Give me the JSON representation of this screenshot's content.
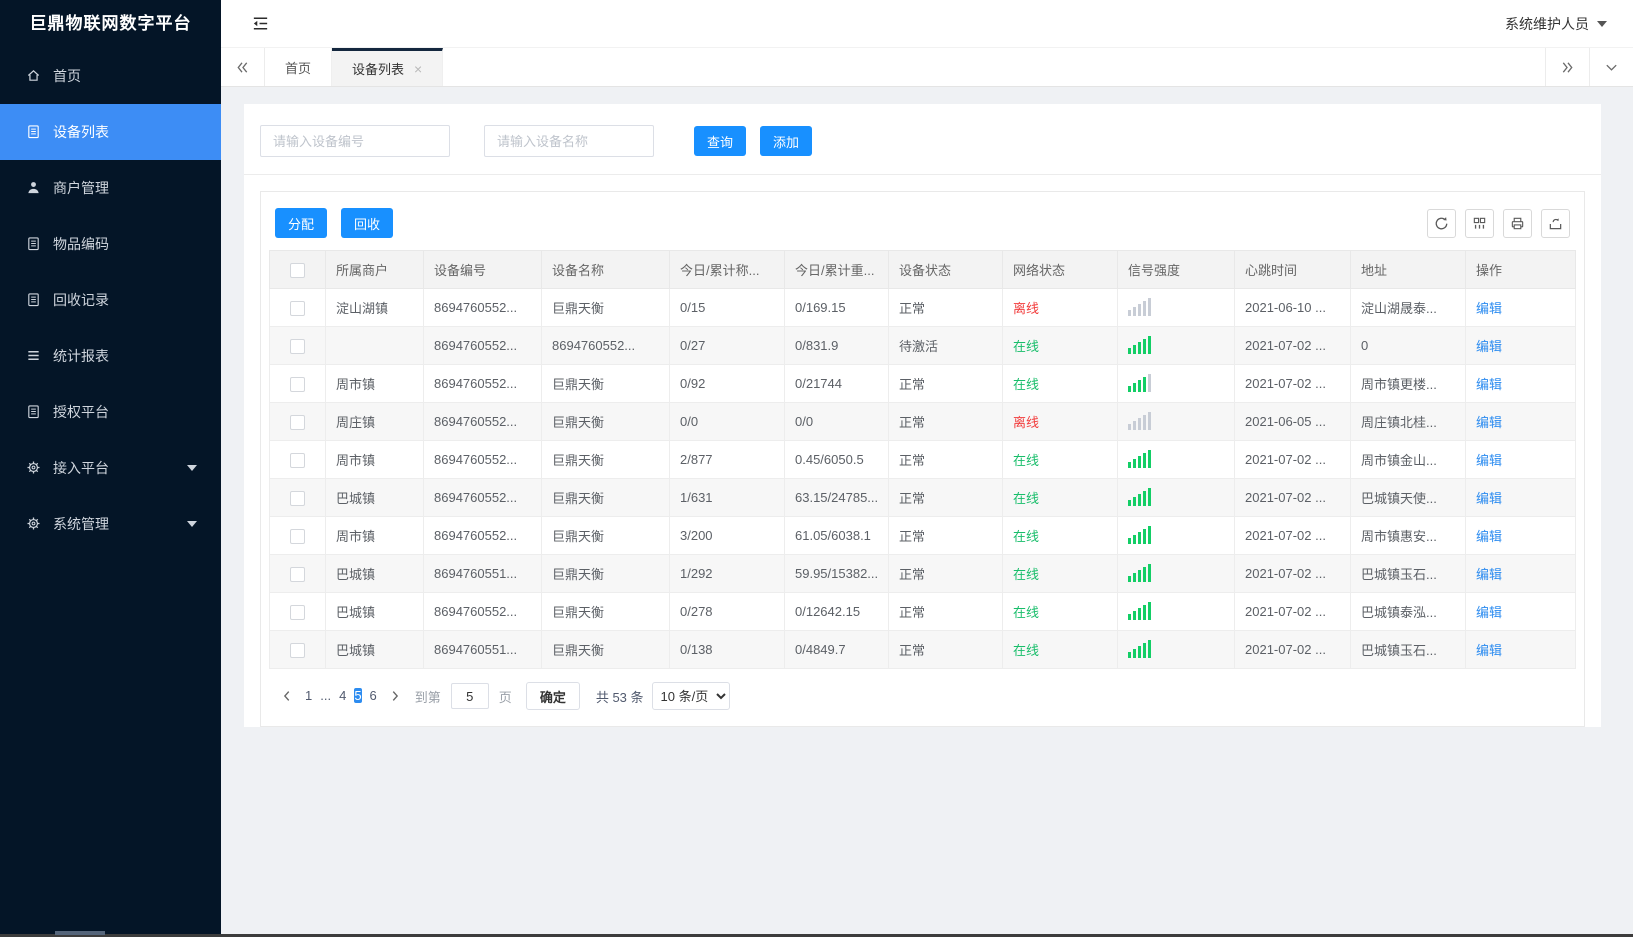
{
  "app": {
    "title": "巨鼎物联网数字平台",
    "user": "系统维护人员"
  },
  "sidebar": {
    "items": [
      {
        "id": "home",
        "label": "首页",
        "icon": "home-icon",
        "active": false,
        "expandable": false
      },
      {
        "id": "device-list",
        "label": "设备列表",
        "icon": "document-icon",
        "active": true,
        "expandable": false
      },
      {
        "id": "merchant-mgmt",
        "label": "商户管理",
        "icon": "user-icon",
        "active": false,
        "expandable": false
      },
      {
        "id": "item-code",
        "label": "物品编码",
        "icon": "document-icon",
        "active": false,
        "expandable": false
      },
      {
        "id": "recycle-record",
        "label": "回收记录",
        "icon": "document-icon",
        "active": false,
        "expandable": false
      },
      {
        "id": "stats-report",
        "label": "统计报表",
        "icon": "list-icon",
        "active": false,
        "expandable": false
      },
      {
        "id": "auth-platform",
        "label": "授权平台",
        "icon": "document-icon",
        "active": false,
        "expandable": false
      },
      {
        "id": "access-platform",
        "label": "接入平台",
        "icon": "gear-icon",
        "active": false,
        "expandable": true
      },
      {
        "id": "system-mgmt",
        "label": "系统管理",
        "icon": "gear-icon",
        "active": false,
        "expandable": true
      }
    ]
  },
  "tabs": [
    {
      "label": "首页",
      "active": false,
      "closable": false
    },
    {
      "label": "设备列表",
      "active": true,
      "closable": true
    }
  ],
  "search": {
    "device_no_placeholder": "请输入设备编号",
    "device_name_placeholder": "请输入设备名称",
    "query_label": "查询",
    "add_label": "添加"
  },
  "toolbar": {
    "assign_label": "分配",
    "recycle_label": "回收"
  },
  "table": {
    "headers": [
      "所属商户",
      "设备编号",
      "设备名称",
      "今日/累计称...",
      "今日/累计重...",
      "设备状态",
      "网络状态",
      "信号强度",
      "心跳时间",
      "地址",
      "操作"
    ],
    "edit_label": "编辑",
    "rows": [
      {
        "merchant": "淀山湖镇",
        "device_no": "8694760552...",
        "device_name": "巨鼎天衡",
        "today_count": "0/15",
        "today_weight": "0/169.15",
        "device_status": "正常",
        "network_status": "离线",
        "signal_level": 0,
        "heartbeat": "2021-06-10 ...",
        "address": "淀山湖晟泰..."
      },
      {
        "merchant": "",
        "device_no": "8694760552...",
        "device_name": "8694760552...",
        "today_count": "0/27",
        "today_weight": "0/831.9",
        "device_status": "待激活",
        "network_status": "在线",
        "signal_level": 5,
        "heartbeat": "2021-07-02 ...",
        "address": "0"
      },
      {
        "merchant": "周市镇",
        "device_no": "8694760552...",
        "device_name": "巨鼎天衡",
        "today_count": "0/92",
        "today_weight": "0/21744",
        "device_status": "正常",
        "network_status": "在线",
        "signal_level": 4,
        "heartbeat": "2021-07-02 ...",
        "address": "周市镇更楼..."
      },
      {
        "merchant": "周庄镇",
        "device_no": "8694760552...",
        "device_name": "巨鼎天衡",
        "today_count": "0/0",
        "today_weight": "0/0",
        "device_status": "正常",
        "network_status": "离线",
        "signal_level": 0,
        "heartbeat": "2021-06-05 ...",
        "address": "周庄镇北桂..."
      },
      {
        "merchant": "周市镇",
        "device_no": "8694760552...",
        "device_name": "巨鼎天衡",
        "today_count": "2/877",
        "today_weight": "0.45/6050.5",
        "device_status": "正常",
        "network_status": "在线",
        "signal_level": 5,
        "heartbeat": "2021-07-02 ...",
        "address": "周市镇金山..."
      },
      {
        "merchant": "巴城镇",
        "device_no": "8694760552...",
        "device_name": "巨鼎天衡",
        "today_count": "1/631",
        "today_weight": "63.15/24785...",
        "device_status": "正常",
        "network_status": "在线",
        "signal_level": 5,
        "heartbeat": "2021-07-02 ...",
        "address": "巴城镇天使..."
      },
      {
        "merchant": "周市镇",
        "device_no": "8694760552...",
        "device_name": "巨鼎天衡",
        "today_count": "3/200",
        "today_weight": "61.05/6038.1",
        "device_status": "正常",
        "network_status": "在线",
        "signal_level": 5,
        "heartbeat": "2021-07-02 ...",
        "address": "周市镇惠安..."
      },
      {
        "merchant": "巴城镇",
        "device_no": "8694760551...",
        "device_name": "巨鼎天衡",
        "today_count": "1/292",
        "today_weight": "59.95/15382...",
        "device_status": "正常",
        "network_status": "在线",
        "signal_level": 5,
        "heartbeat": "2021-07-02 ...",
        "address": "巴城镇玉石..."
      },
      {
        "merchant": "巴城镇",
        "device_no": "8694760552...",
        "device_name": "巨鼎天衡",
        "today_count": "0/278",
        "today_weight": "0/12642.15",
        "device_status": "正常",
        "network_status": "在线",
        "signal_level": 5,
        "heartbeat": "2021-07-02 ...",
        "address": "巴城镇泰泓..."
      },
      {
        "merchant": "巴城镇",
        "device_no": "8694760551...",
        "device_name": "巨鼎天衡",
        "today_count": "0/138",
        "today_weight": "0/4849.7",
        "device_status": "正常",
        "network_status": "在线",
        "signal_level": 5,
        "heartbeat": "2021-07-02 ...",
        "address": "巴城镇玉石..."
      }
    ]
  },
  "pagination": {
    "pages": [
      {
        "label": "1",
        "active": false
      },
      {
        "label": "...",
        "active": false
      },
      {
        "label": "4",
        "active": false
      },
      {
        "label": "5",
        "active": true
      },
      {
        "label": "6",
        "active": false
      }
    ],
    "jump_prefix": "到第",
    "jump_value": "5",
    "jump_suffix": "页",
    "confirm_label": "确定",
    "total_label": "共 53 条",
    "page_size_label": "10 条/页"
  },
  "colors": {
    "accent": "#1890ff",
    "sidebar_bg": "#041527",
    "sidebar_active": "#3d8df5",
    "online_green": "#19be6b",
    "offline_red": "#f23c3c",
    "signal_green": "#13ce66",
    "signal_gray": "#c8cdd6",
    "link_blue": "#2d8cf0",
    "pagination_active": "#2d8cf0"
  }
}
